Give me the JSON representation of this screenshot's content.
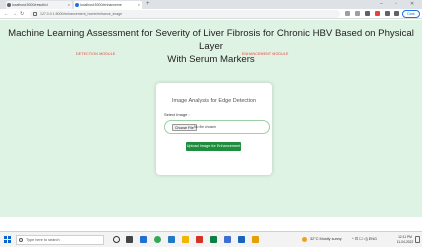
{
  "browser": {
    "tabs": [
      {
        "title": "localhost:5000/result/cl"
      },
      {
        "title": "localhost:5000/enhanceme"
      }
    ],
    "new_tab": "+",
    "address": "127.0.0.1:5000/enhancement_home/enhance_image",
    "controls": {
      "minimize": "–",
      "maximize": "▫",
      "close": "✕"
    },
    "profile_label": "Dark"
  },
  "page": {
    "title_line1": "Machine Learning Assessment for Severity of Liver Fibrosis for Chronic HBV Based on Physical Layer",
    "title_line2": "With Serum Markers",
    "nav": {
      "left": "DETECTION MODULE",
      "right": "ENHANCEMENT MODULE"
    },
    "card": {
      "heading": "Image Analysis for Edge Detection",
      "label": "Select Image :",
      "file_button": "Choose File",
      "file_status": "No file chosen",
      "submit": "Upload Image for Enhancement"
    }
  },
  "taskbar": {
    "search_placeholder": "Type here to search",
    "weather": "32°C Mostly sunny",
    "time": "12:11 PM",
    "date": "11-04-2022",
    "tray_symbols": "^  ⊡  ☐  ◁)  ENG"
  },
  "colors": {
    "page_bg": "#dff3e4",
    "accent_red": "#e53935",
    "button_green": "#1e8e3e"
  }
}
